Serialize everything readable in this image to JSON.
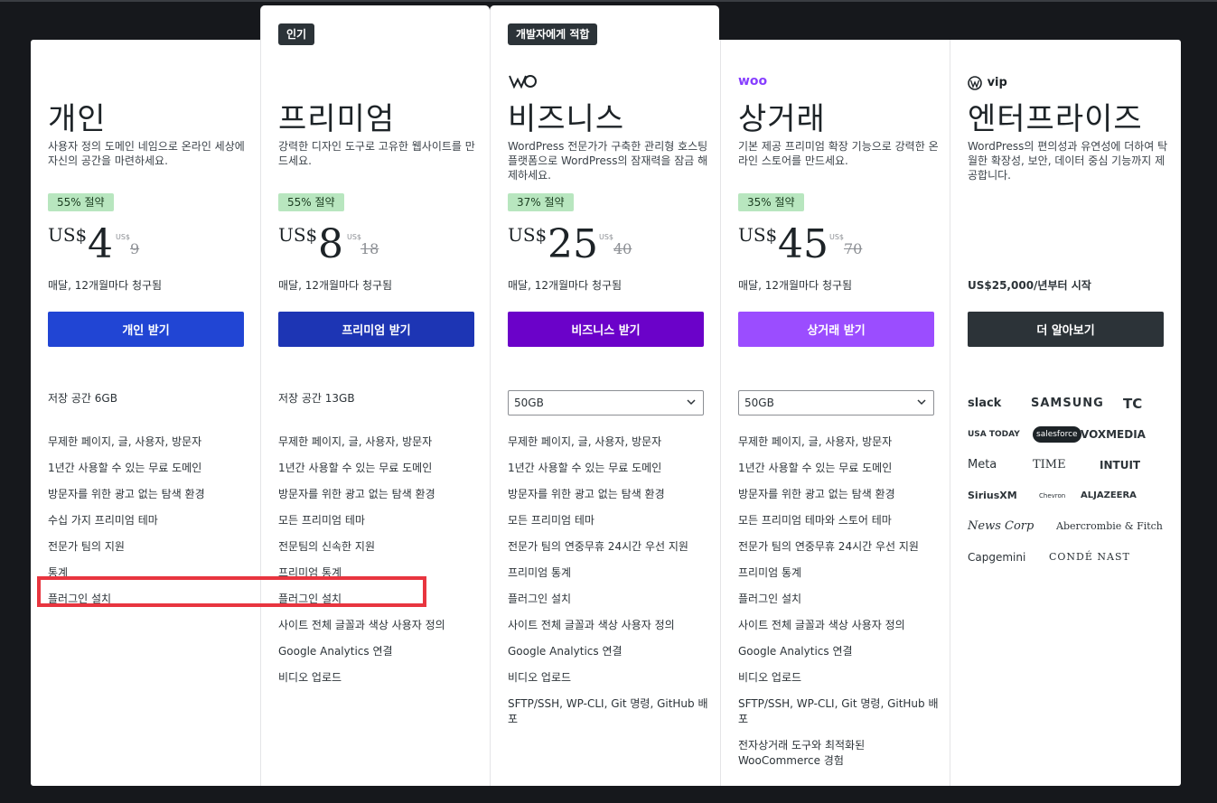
{
  "plans": [
    {
      "name": "개인",
      "description": "사용자 정의 도메인 네임으로 온라인 세상에 자신의 공간을 마련하세요.",
      "savings": "55% 절약",
      "currency": "US$",
      "price": "4",
      "original_currency": "US$",
      "original_price": "9",
      "billing": "매달, 12개월마다 청구됨",
      "cta": "개인 받기",
      "cta_color": "#2145d4",
      "storage": "저장 공간 6GB",
      "features": [
        "무제한 페이지, 글, 사용자, 방문자",
        "1년간 사용할 수 있는 무료 도메인",
        "방문자를 위한 광고 없는 탐색 환경",
        "수십 가지 프리미엄 테마",
        "전문가 팀의 지원",
        "통계",
        "플러그인 설치"
      ]
    },
    {
      "badge": "인기",
      "name": "프리미엄",
      "description": "강력한 디자인 도구로 고유한 웹사이트를 만드세요.",
      "savings": "55% 절약",
      "currency": "US$",
      "price": "8",
      "original_currency": "US$",
      "original_price": "18",
      "billing": "매달, 12개월마다 청구됨",
      "cta": "프리미엄 받기",
      "cta_color": "#1d35b4",
      "storage": "저장 공간 13GB",
      "features": [
        "무제한 페이지, 글, 사용자, 방문자",
        "1년간 사용할 수 있는 무료 도메인",
        "방문자를 위한 광고 없는 탐색 환경",
        "모든 프리미엄 테마",
        "전문팀의 신속한 지원",
        "프리미엄 통계",
        "플러그인 설치",
        "사이트 전체 글꼴과 색상 사용자 정의",
        "Google Analytics 연결",
        "비디오 업로드"
      ]
    },
    {
      "badge": "개발자에게 적합",
      "logo_icon": "wordpress-logo-icon",
      "name": "비즈니스",
      "description": "WordPress 전문가가 구축한 관리형 호스팅 플랫폼으로 WordPress의 잠재력을 잠금 해제하세요.",
      "savings": "37% 절약",
      "currency": "US$",
      "price": "25",
      "original_currency": "US$",
      "original_price": "40",
      "billing": "매달, 12개월마다 청구됨",
      "cta": "비즈니스 받기",
      "cta_color": "#6b02c9",
      "storage_select": "50GB",
      "features": [
        "무제한 페이지, 글, 사용자, 방문자",
        "1년간 사용할 수 있는 무료 도메인",
        "방문자를 위한 광고 없는 탐색 환경",
        "모든 프리미엄 테마",
        "전문가 팀의 연중무휴 24시간 우선 지원",
        "프리미엄 통계",
        "플러그인 설치",
        "사이트 전체 글꼴과 색상 사용자 정의",
        "Google Analytics 연결",
        "비디오 업로드",
        "SFTP/SSH, WP-CLI, Git 명령, GitHub 배포"
      ]
    },
    {
      "logo": "woo",
      "logo_color": "#873eff",
      "name": "상거래",
      "description": "기본 제공 프리미엄 확장 기능으로 강력한 온라인 스토어를 만드세요.",
      "savings": "35% 절약",
      "currency": "US$",
      "price": "45",
      "original_currency": "US$",
      "original_price": "70",
      "billing": "매달, 12개월마다 청구됨",
      "cta": "상거래 받기",
      "cta_color": "#9b4dff",
      "storage_select": "50GB",
      "features": [
        "무제한 페이지, 글, 사용자, 방문자",
        "1년간 사용할 수 있는 무료 도메인",
        "방문자를 위한 광고 없는 탐색 환경",
        "모든 프리미엄 테마와 스토어 테마",
        "전문가 팀의 연중무휴 24시간 우선 지원",
        "프리미엄 통계",
        "플러그인 설치",
        "사이트 전체 글꼴과 색상 사용자 정의",
        "Google Analytics 연결",
        "비디오 업로드",
        "SFTP/SSH, WP-CLI, Git 명령, GitHub 배포",
        "전자상거래 도구와 최적화된 WooCommerce 경험"
      ]
    },
    {
      "logo": "vip",
      "name": "엔터프라이즈",
      "description": "WordPress의 편의성과 유연성에 더하여 탁월한 확장성, 보안, 데이터 중심 기능까지 제공합니다.",
      "billing": "US$25,000/년부터 시작",
      "cta": "더 알아보기",
      "cta_color": "#2c3338",
      "brands": [
        [
          "slack",
          "SAMSUNG",
          "TC"
        ],
        [
          "USA TODAY",
          "salesforce",
          "VOXMEDIA"
        ],
        [
          "Meta",
          "TIME",
          "INTUIT"
        ],
        [
          "SiriusXM",
          "Chevron",
          "ALJAZEERA"
        ],
        [
          "News Corp",
          "Abercrombie & Fitch"
        ],
        [
          "Capgemini",
          "CONDÉ NAST"
        ]
      ]
    }
  ]
}
